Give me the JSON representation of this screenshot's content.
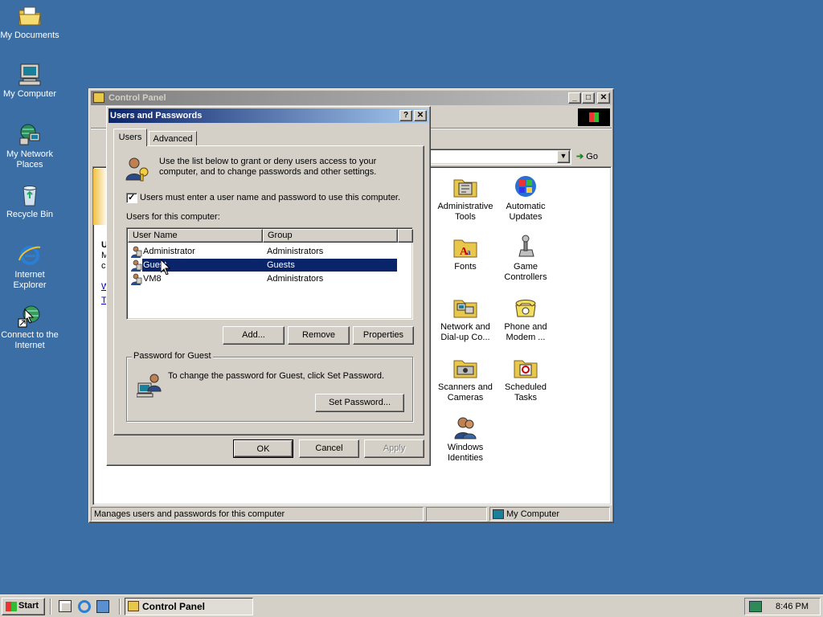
{
  "desktop": {
    "icons": [
      {
        "label": "My Documents",
        "icon": "folder-documents-icon"
      },
      {
        "label": "My Computer",
        "icon": "computer-icon"
      },
      {
        "label": "My Network Places",
        "icon": "network-places-icon"
      },
      {
        "label": "Recycle Bin",
        "icon": "recycle-bin-icon"
      },
      {
        "label": "Internet Explorer",
        "icon": "internet-explorer-icon"
      },
      {
        "label": "Connect to the Internet",
        "icon": "connect-internet-icon"
      }
    ]
  },
  "control_panel": {
    "title": "Control Panel",
    "go_label": "Go",
    "items": [
      {
        "label": "Administrative Tools",
        "icon": "administrative-tools-icon"
      },
      {
        "label": "Automatic Updates",
        "icon": "automatic-updates-icon"
      },
      {
        "label": "Fonts",
        "icon": "fonts-icon"
      },
      {
        "label": "Game Controllers",
        "icon": "game-controllers-icon"
      },
      {
        "label": "Network and Dial-up Co...",
        "icon": "network-dialup-icon"
      },
      {
        "label": "Phone and Modem ...",
        "icon": "phone-modem-icon"
      },
      {
        "label": "Scanners and Cameras",
        "icon": "scanners-cameras-icon"
      },
      {
        "label": "Scheduled Tasks",
        "icon": "scheduled-tasks-icon"
      },
      {
        "label": "Windows Identities",
        "icon": "windows-identities-icon"
      }
    ],
    "status_text": "Manages users and passwords for this computer",
    "status_zone": "My Computer",
    "left_partial": [
      "U",
      "M",
      "c",
      "W",
      "T"
    ]
  },
  "dialog": {
    "title": "Users and Passwords",
    "tabs": [
      "Users",
      "Advanced"
    ],
    "intro_text": "Use the list below to grant or deny users access to your computer, and to change passwords and other settings.",
    "checkbox_label": "Users must enter a user name and password to use this computer.",
    "checkbox_checked": true,
    "list_label": "Users for this computer:",
    "columns": [
      "User Name",
      "Group"
    ],
    "users": [
      {
        "name": "Administrator",
        "group": "Administrators",
        "selected": false
      },
      {
        "name": "Guest",
        "group": "Guests",
        "selected": true
      },
      {
        "name": "VM8",
        "group": "Administrators",
        "selected": false
      }
    ],
    "add_label": "Add...",
    "remove_label": "Remove",
    "properties_label": "Properties",
    "password_group_label": "Password for Guest",
    "password_text": "To change the password for Guest, click Set Password.",
    "set_password_label": "Set Password...",
    "ok_label": "OK",
    "cancel_label": "Cancel",
    "apply_label": "Apply"
  },
  "taskbar": {
    "start_label": "Start",
    "task_label": "Control Panel",
    "clock": "8:46 PM"
  },
  "colors": {
    "desktop": "#3a6ea5",
    "face": "#d4d0c8",
    "title_active": "#0a246a",
    "title_active_end": "#a6caf0",
    "title_inactive": "#808080",
    "selection": "#0a246a"
  }
}
